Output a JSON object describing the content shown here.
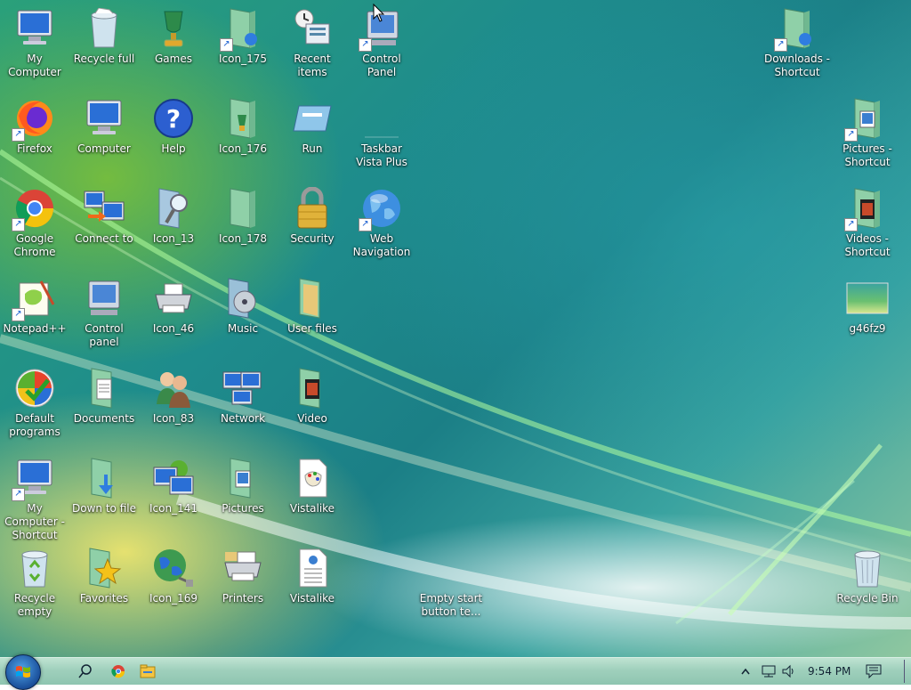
{
  "desktop": {
    "icons": [
      {
        "label": "My Computer",
        "icon": "monitor-icon"
      },
      {
        "label": "Recycle full",
        "icon": "recycle-bin-full-icon"
      },
      {
        "label": "Games",
        "icon": "games-trophy-icon"
      },
      {
        "label": "Icon_175",
        "icon": "folder-shortcut-icon"
      },
      {
        "label": "Recent items",
        "icon": "recent-items-icon"
      },
      {
        "label": "Control Panel",
        "icon": "control-panel-icon"
      },
      {
        "label": "Downloads - Shortcut",
        "icon": "folder-shortcut-icon"
      },
      {
        "label": "Firefox",
        "icon": "firefox-icon"
      },
      {
        "label": "Computer",
        "icon": "computer-icon"
      },
      {
        "label": "Help",
        "icon": "help-icon"
      },
      {
        "label": "Icon_176",
        "icon": "folder-icon"
      },
      {
        "label": "Run",
        "icon": "run-icon"
      },
      {
        "label": "Taskbar Vista Plus",
        "icon": "blank-icon"
      },
      {
        "label": "Pictures - Shortcut",
        "icon": "pictures-folder-icon"
      },
      {
        "label": "Google Chrome",
        "icon": "chrome-icon"
      },
      {
        "label": "Connect to",
        "icon": "connect-to-icon"
      },
      {
        "label": "Icon_13",
        "icon": "search-folder-icon"
      },
      {
        "label": "Icon_178",
        "icon": "folder-icon"
      },
      {
        "label": "Security",
        "icon": "padlock-icon"
      },
      {
        "label": "Web Navigation",
        "icon": "globe-icon"
      },
      {
        "label": "Videos - Shortcut",
        "icon": "videos-folder-icon"
      },
      {
        "label": "Notepad++",
        "icon": "notepad-plus-plus-icon"
      },
      {
        "label": "Control panel",
        "icon": "control-panel-icon"
      },
      {
        "label": "Icon_46",
        "icon": "printer-icon"
      },
      {
        "label": "Music",
        "icon": "music-folder-icon"
      },
      {
        "label": "User files",
        "icon": "user-files-folder-icon"
      },
      {
        "label": "g46fz9",
        "icon": "image-thumbnail-icon"
      },
      {
        "label": "Default programs",
        "icon": "default-programs-icon"
      },
      {
        "label": "Documents",
        "icon": "documents-folder-icon"
      },
      {
        "label": "Icon_83",
        "icon": "users-icon"
      },
      {
        "label": "Network",
        "icon": "network-icon"
      },
      {
        "label": "Video",
        "icon": "video-folder-icon"
      },
      {
        "label": "My Computer - Shortcut",
        "icon": "monitor-icon"
      },
      {
        "label": "Down to file",
        "icon": "download-folder-icon"
      },
      {
        "label": "Icon_141",
        "icon": "network-computers-icon"
      },
      {
        "label": "Pictures",
        "icon": "pictures-folder-icon"
      },
      {
        "label": "Vistalike",
        "icon": "paint-document-icon"
      },
      {
        "label": "Recycle empty",
        "icon": "recycle-bin-empty-icon"
      },
      {
        "label": "Favorites",
        "icon": "favorites-star-icon"
      },
      {
        "label": "Icon_169",
        "icon": "network-globe-icon"
      },
      {
        "label": "Printers",
        "icon": "printers-icon"
      },
      {
        "label": "Vistalike",
        "icon": "html-document-icon"
      },
      {
        "label": "Empty start button te...",
        "icon": "blank-icon"
      },
      {
        "label": "Recycle Bin",
        "icon": "recycle-bin-empty-icon"
      }
    ]
  },
  "taskbar": {
    "clock": "9:54 PM",
    "start_icon": "windows-start-orb-icon",
    "pinned": [
      "search-icon",
      "chrome-icon",
      "file-explorer-icon"
    ],
    "tray": [
      "show-hidden-icons-icon",
      "network-icon",
      "volume-icon",
      "notifications-icon"
    ]
  },
  "colors": {
    "taskbar": "#9fd0bc",
    "desktop_primary": "#1e8c8c"
  }
}
